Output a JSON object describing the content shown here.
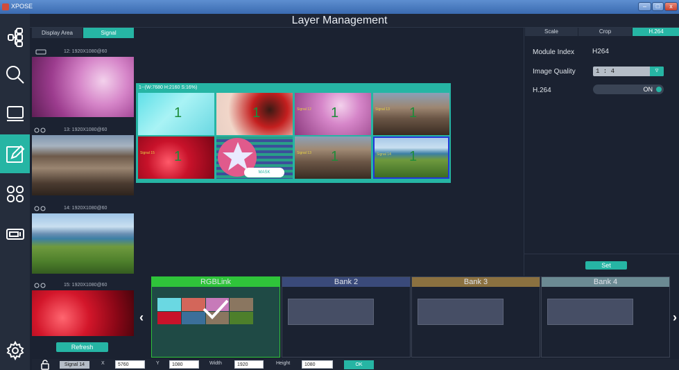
{
  "window": {
    "app_name": "XPOSE",
    "title": "Layer Management"
  },
  "left_panel": {
    "tabs": [
      {
        "label": "Display Area",
        "active": false
      },
      {
        "label": "Signal",
        "active": true
      }
    ],
    "signals": [
      {
        "label": "12: 1920X1080@60"
      },
      {
        "label": "13: 1920X1080@60"
      },
      {
        "label": "14: 1920X1080@60"
      },
      {
        "label": "15: 1920X1080@60"
      }
    ],
    "refresh_label": "Refresh"
  },
  "layer": {
    "caption": "1--(W:7680 H:2160 S:16%)",
    "mask_label": "MASK"
  },
  "right_panel": {
    "tabs": [
      {
        "label": "Scale",
        "active": false
      },
      {
        "label": "Crop",
        "active": false
      },
      {
        "label": "H.264",
        "active": true
      }
    ],
    "module_index_label": "Module Index",
    "module_index_value": "H264",
    "image_quality_label": "Image Quality",
    "image_quality_value": "1 : 4",
    "h264_label": "H.264",
    "h264_toggle": "ON",
    "set_label": "Set"
  },
  "banks": [
    {
      "label": "RGBLink",
      "color": "#2fc43a"
    },
    {
      "label": "Bank 2",
      "color": "#3a4a7a"
    },
    {
      "label": "Bank 3",
      "color": "#8b7140"
    },
    {
      "label": "Bank 4",
      "color": "#6b8a93"
    }
  ],
  "bottom_bar": {
    "signal": "Signal 14",
    "x_label": "X",
    "x_value": "5760",
    "y_label": "Y",
    "y_value": "1080",
    "width_label": "Width",
    "width_value": "1920",
    "height_label": "Height",
    "height_value": "1080",
    "ok_label": "OK"
  },
  "colors": {
    "accent": "#26b5a4",
    "background": "#1b2231"
  }
}
